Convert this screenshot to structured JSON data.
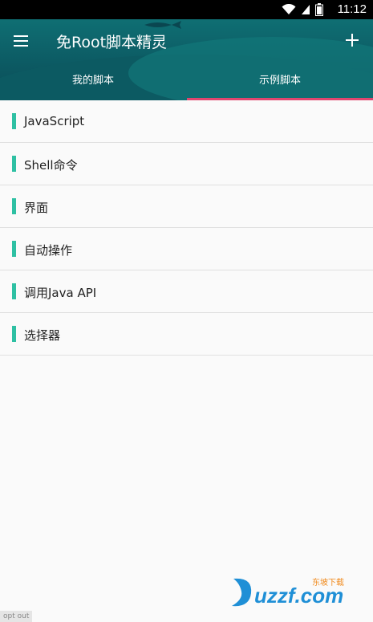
{
  "status": {
    "time": "11:12",
    "icons": [
      "wifi-icon",
      "signal-icon",
      "battery-icon"
    ]
  },
  "app_bar": {
    "title": "免Root脚本精灵",
    "menu_icon": "menu-icon",
    "add_icon": "add-icon"
  },
  "tabs": [
    {
      "label": "我的脚本",
      "active": false
    },
    {
      "label": "示例脚本",
      "active": true
    }
  ],
  "list": [
    {
      "label": "JavaScript"
    },
    {
      "label": "Shell命令"
    },
    {
      "label": "界面"
    },
    {
      "label": "自动操作"
    },
    {
      "label": "调用Java API"
    },
    {
      "label": "选择器"
    }
  ],
  "footer": {
    "opt_out": "opt out"
  },
  "watermark": {
    "text": "uzzf.com",
    "sub": "东坡下载"
  },
  "colors": {
    "app_bar": "#0f6f73",
    "accent": "#e0466f",
    "list_bar": "#2ec0a3"
  }
}
